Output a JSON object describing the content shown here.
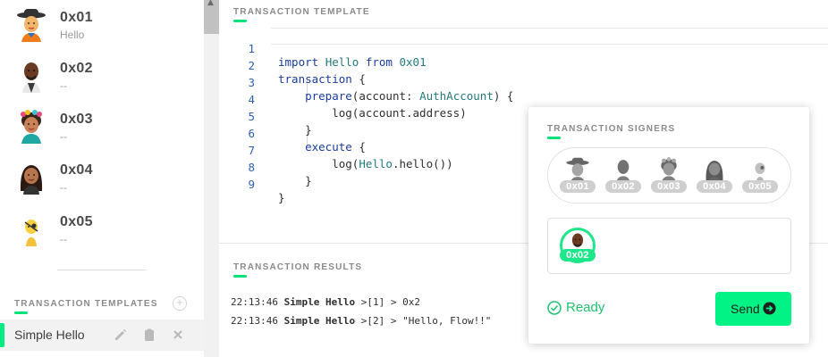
{
  "accounts": [
    {
      "name": "0x01",
      "status": "Hello",
      "avatar_icon": "avatar-hat-woman-icon"
    },
    {
      "name": "0x02",
      "status": "--",
      "avatar_icon": "avatar-bald-man-icon"
    },
    {
      "name": "0x03",
      "status": "--",
      "avatar_icon": "avatar-flower-woman-icon"
    },
    {
      "name": "0x04",
      "status": "--",
      "avatar_icon": "avatar-long-hair-woman-icon"
    },
    {
      "name": "0x05",
      "status": "--",
      "avatar_icon": "avatar-eyepatch-icon"
    }
  ],
  "sidebar": {
    "templates_heading": "TRANSACTION TEMPLATES",
    "add_icon": "plus-circle-icon",
    "template_item": {
      "label": "Simple Hello",
      "icons": [
        "pencil-icon",
        "clipboard-icon",
        "close-icon"
      ]
    }
  },
  "editor": {
    "heading": "TRANSACTION TEMPLATE",
    "lines": [
      {
        "num": "1",
        "text": "import Hello from 0x01"
      },
      {
        "num": "2",
        "text": "transaction {"
      },
      {
        "num": "3",
        "text": "    prepare(account: AuthAccount) {"
      },
      {
        "num": "4",
        "text": "        log(account.address)"
      },
      {
        "num": "5",
        "text": "    }"
      },
      {
        "num": "6",
        "text": "    execute {"
      },
      {
        "num": "7",
        "text": "        log(Hello.hello())"
      },
      {
        "num": "8",
        "text": "    }"
      },
      {
        "num": "9",
        "text": "}"
      }
    ]
  },
  "results": {
    "heading": "TRANSACTION RESULTS",
    "logs": [
      {
        "time": "22:13:46",
        "name": "Simple Hello",
        "index": ">[1] >",
        "value": "0x2"
      },
      {
        "time": "22:13:46",
        "name": "Simple Hello",
        "index": ">[2] >",
        "value": "\"Hello, Flow!!\""
      }
    ]
  },
  "signers": {
    "heading": "TRANSACTION SIGNERS",
    "pool": [
      "0x01",
      "0x02",
      "0x03",
      "0x04",
      "0x05"
    ],
    "selected": [
      "0x02"
    ],
    "status": "Ready",
    "send_label": "Send"
  },
  "colors": {
    "accent": "#00EF80",
    "ready": "#20C26D"
  }
}
